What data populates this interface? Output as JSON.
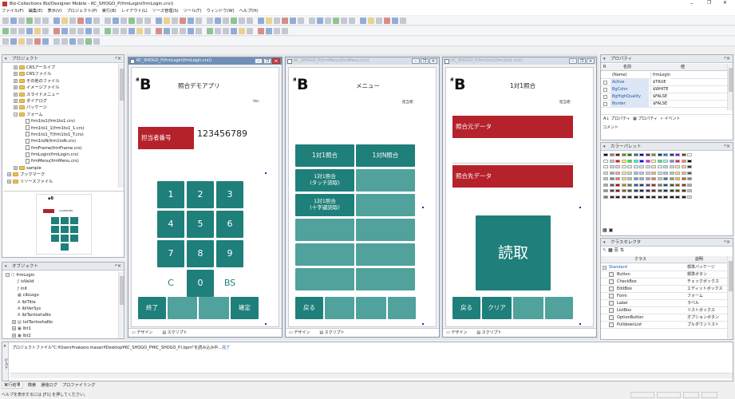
{
  "window": {
    "title": "Biz-Collections Biz/Designer Mobile - KC_SHOGO_P(frmLogin(frmLogin.crs))",
    "controls": [
      "–",
      "❐",
      "✕"
    ]
  },
  "menubar": [
    "ファイル(F)",
    "編集(E)",
    "表示(V)",
    "プロジェクト(P)",
    "実行(B)",
    "レイアウト(L)",
    "ソース管理(S)",
    "ツール(T)",
    "ウィンドウ(W)",
    "ヘルプ(H)"
  ],
  "toolbar_colors": {
    "blue": "#3e6fb8",
    "green": "#3b9a3b",
    "red": "#c0392b",
    "gray": "#9aa3ae",
    "yellow": "#e0b23a"
  },
  "project_pane": {
    "title": "プロジェクト",
    "items": [
      {
        "label": "CRSアーカイブ",
        "type": "folder",
        "depth": 1,
        "exp": "+"
      },
      {
        "label": "CRSファイル",
        "type": "folder",
        "depth": 1,
        "exp": "+"
      },
      {
        "label": "その他のファイル",
        "type": "folder",
        "depth": 1,
        "exp": "+"
      },
      {
        "label": "イメージファイル",
        "type": "folder",
        "depth": 1,
        "exp": "+"
      },
      {
        "label": "スライドメニュー",
        "type": "folder",
        "depth": 1,
        "exp": "+"
      },
      {
        "label": "ダイアログ",
        "type": "folder",
        "depth": 1,
        "exp": "+"
      },
      {
        "label": "パッケージ",
        "type": "folder",
        "depth": 1,
        "exp": "+"
      },
      {
        "label": "フォーム",
        "type": "folder",
        "depth": 1,
        "exp": "−"
      },
      {
        "label": "frm1to1(frm1to1.crs)",
        "type": "file",
        "depth": 2
      },
      {
        "label": "frm1to1_1(frm1to1_1.crs)",
        "type": "file",
        "depth": 2
      },
      {
        "label": "frm1to1_T(frm1to1_T.crs)",
        "type": "file",
        "depth": 2
      },
      {
        "label": "frm1toN(frm1toN.crs)",
        "type": "file",
        "depth": 2
      },
      {
        "label": "frmFrame(frmFrame.crs)",
        "type": "file",
        "depth": 2
      },
      {
        "label": "frmLogin(frmLogin.crs)",
        "type": "file",
        "depth": 2
      },
      {
        "label": "frmMenu(frmMenu.crs)",
        "type": "file",
        "depth": 2
      },
      {
        "label": "sample",
        "type": "folder",
        "depth": 1,
        "exp": "+"
      },
      {
        "label": "ブックマーク",
        "type": "folder",
        "depth": 0,
        "exp": "+"
      },
      {
        "label": "リソースファイル",
        "type": "folder",
        "depth": 0,
        "exp": "+"
      }
    ]
  },
  "object_pane": {
    "title": "オブジェクト",
    "items": [
      {
        "label": "frmLogin",
        "icon": "☐",
        "depth": 0,
        "exp": "−"
      },
      {
        "label": "isValid",
        "icon": "ƒ",
        "depth": 1
      },
      {
        "label": "init",
        "icon": "ƒ",
        "depth": 1
      },
      {
        "label": "clbLogo",
        "icon": "▦",
        "depth": 1
      },
      {
        "label": "lblTitle",
        "icon": "A",
        "depth": 1
      },
      {
        "label": "lblVerSys",
        "icon": "A",
        "depth": 1
      },
      {
        "label": "lblTantoshaNo",
        "icon": "A",
        "depth": 1
      },
      {
        "label": "txtTantoshaNo",
        "icon": "▤",
        "depth": 1,
        "exp": "+"
      },
      {
        "label": "lbt1",
        "icon": "▣",
        "depth": 1,
        "exp": "+"
      },
      {
        "label": "lbt2",
        "icon": "▣",
        "depth": 1,
        "exp": "+"
      }
    ]
  },
  "form_login": {
    "title": "KC_SHOGO_P(frmLogin(frmLogin.crs))",
    "logo_side": "Biz",
    "logo": "B",
    "app_title": "照合デモアプリ",
    "version": "Ver.",
    "tantosha_label": "担当者番号",
    "tantosha_value": "123456789",
    "keys": [
      "1",
      "2",
      "3",
      "4",
      "5",
      "6",
      "7",
      "8",
      "9",
      "C",
      "0",
      "BS"
    ],
    "footer_left": "終了",
    "footer_right": "確定",
    "tabs": [
      "デザイン",
      "スクリプト"
    ]
  },
  "form_menu": {
    "title": "KC_SHOGO_P(frmMenu(frmMenu.crs))",
    "logo_side": "Biz",
    "logo": "B",
    "app_title": "メニュー",
    "user_label": "担当者:",
    "buttons": [
      "1対1照合",
      "1対N照合",
      "1対1照合\n(タッチ読取)",
      "1対1照合\n(十字键読取)"
    ],
    "footer_left": "戻る",
    "tabs": [
      "デザイン",
      "スクリプト"
    ]
  },
  "form_1to1": {
    "title": "KC_SHOGO_P(frm1to1(frm1to1.crs))",
    "logo_side": "Biz",
    "logo": "B",
    "app_title": "1対1照合",
    "user_label": "担当者:",
    "source_label": "照合元データ",
    "target_label": "照合先データ",
    "read_button": "読取",
    "footer_left": "戻る",
    "footer_clear": "クリア",
    "tabs": [
      "デザイン",
      "スクリプト"
    ]
  },
  "property_pane": {
    "title": "プロパティ",
    "col_name": "名前",
    "col_value": "値",
    "rows": [
      {
        "k": "(Name)",
        "v": "frmLogin"
      },
      {
        "k": "Active",
        "v": "$TRUE"
      },
      {
        "k": "BgColor",
        "v": "$WHITE"
      },
      {
        "k": "BgHighQuality",
        "v": "$FALSE"
      },
      {
        "k": "Border",
        "v": "$FALSE"
      }
    ],
    "tabs": [
      "プロパティ",
      "プロパティ",
      "イベント"
    ],
    "comment_label": "コメント"
  },
  "palette_pane": {
    "title": "カラーパレット"
  },
  "class_pane": {
    "title": "クラスセレクタ",
    "col_class": "クラス",
    "col_desc": "説明",
    "rows": [
      {
        "c": "Standard",
        "d": "標準パッケージ",
        "exp": "−"
      },
      {
        "c": "Button",
        "d": "標準ボタン"
      },
      {
        "c": "CheckBox",
        "d": "チェックボックス"
      },
      {
        "c": "EditBox",
        "d": "エディットボックス"
      },
      {
        "c": "Form",
        "d": "フォーム"
      },
      {
        "c": "Label",
        "d": "ラベル"
      },
      {
        "c": "ListBox",
        "d": "リストボックス"
      },
      {
        "c": "OptionButton",
        "d": "オプションボタン"
      },
      {
        "c": "PulldownList",
        "d": "プルダウンリスト"
      }
    ]
  },
  "output": {
    "message": "プロジェクトファイル\"C:¥Users¥nakano.masan¥Desktop¥KC_SHOGO_P¥KC_SHOGO_P.l.bpm\"を読み込み中...",
    "message_done": "完了",
    "side_label": "ビルド",
    "tabs": [
      "実行結果",
      "検索",
      "通信ログ",
      "プロファイリング"
    ]
  },
  "status": "ヘルプを表示するには [F1] を押してください。",
  "colors": {
    "teal": "#1f7f7a",
    "red": "#b5222b",
    "titlebar_active": "#6f8fb5"
  }
}
